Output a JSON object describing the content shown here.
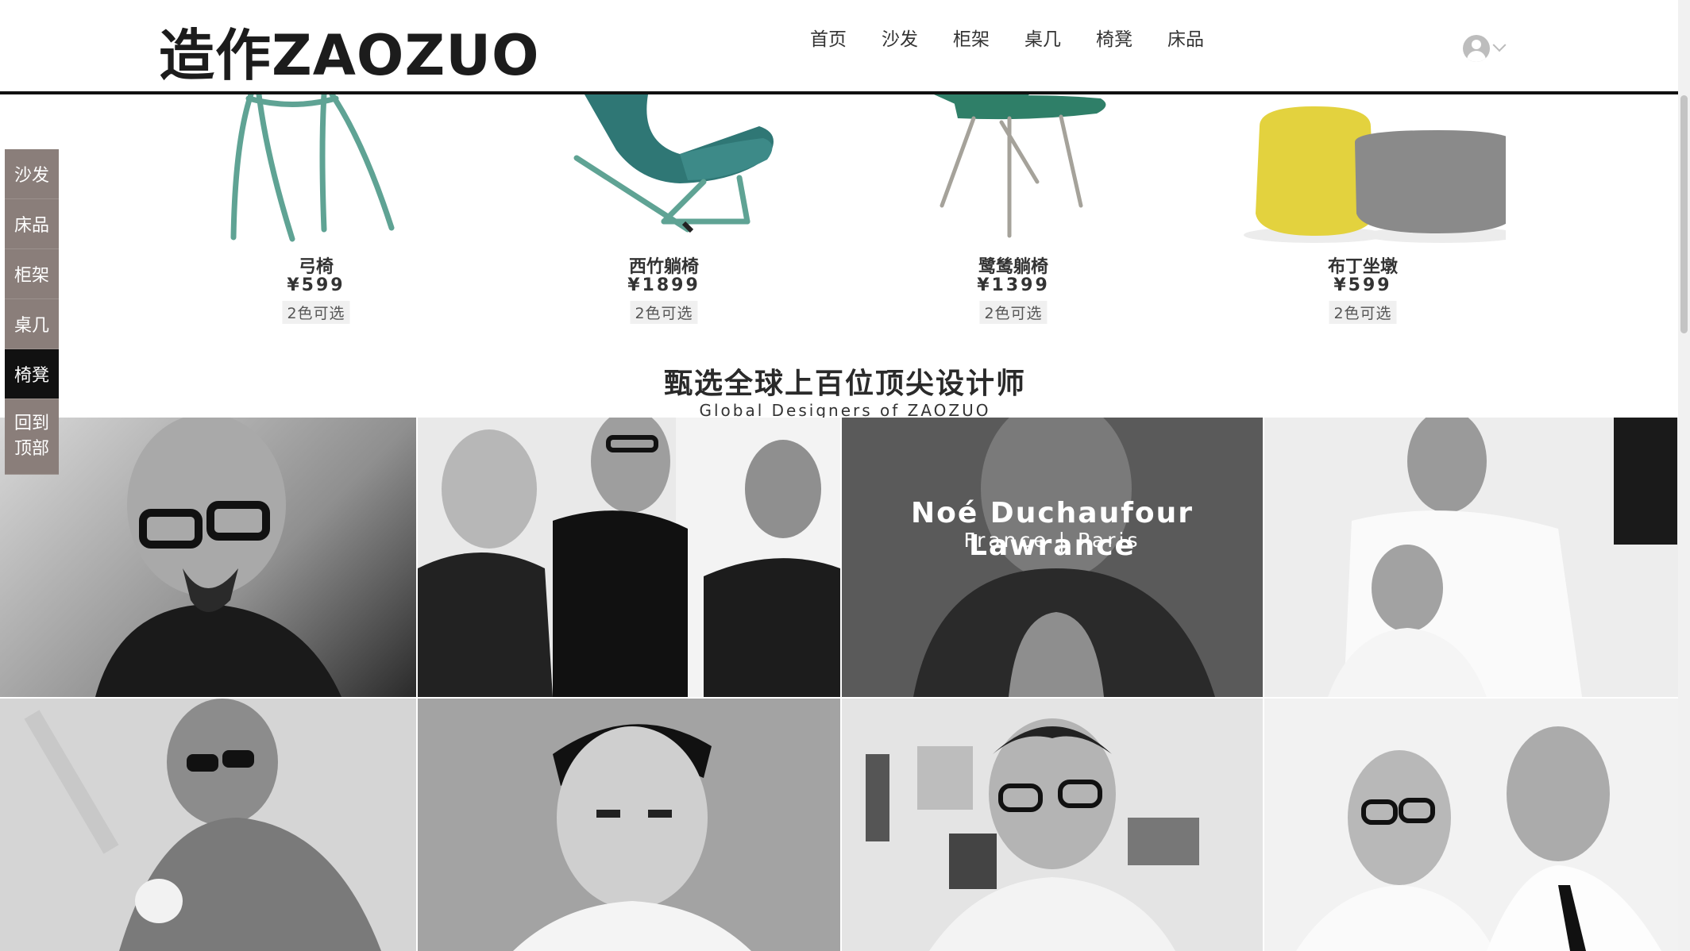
{
  "header": {
    "logo": "造作ZAOZUO",
    "nav": [
      "首页",
      "沙发",
      "柜架",
      "桌几",
      "椅凳",
      "床品"
    ]
  },
  "sidenav": {
    "items": [
      "沙发",
      "床品",
      "柜架",
      "桌几",
      "椅凳"
    ],
    "active": "椅凳",
    "back_to_top": "回到顶部"
  },
  "products": [
    {
      "name": "弓椅",
      "price": "¥599",
      "colors": "2色可选"
    },
    {
      "name": "西竹躺椅",
      "price": "¥1899",
      "colors": "2色可选"
    },
    {
      "name": "鹭鸶躺椅",
      "price": "¥1399",
      "colors": "2色可选"
    },
    {
      "name": "布丁坐墩",
      "price": "¥599",
      "colors": "2色可选"
    }
  ],
  "designers": {
    "title": "甄选全球上百位顶尖设计师",
    "subtitle": "Global Designers of ZAOZUO",
    "featured_name": "Noé Duchaufour Lawrance",
    "featured_location": "France | Paris"
  },
  "colors": {
    "sidenav_bg": "#8a7e7a",
    "sidenav_active": "#111111",
    "chair_teal": "#5fa394",
    "lounge_teal": "#2f7775",
    "egret_green": "#2f7f68",
    "pouf_yellow": "#e3d23e",
    "pouf_grey": "#8a8a8a"
  }
}
